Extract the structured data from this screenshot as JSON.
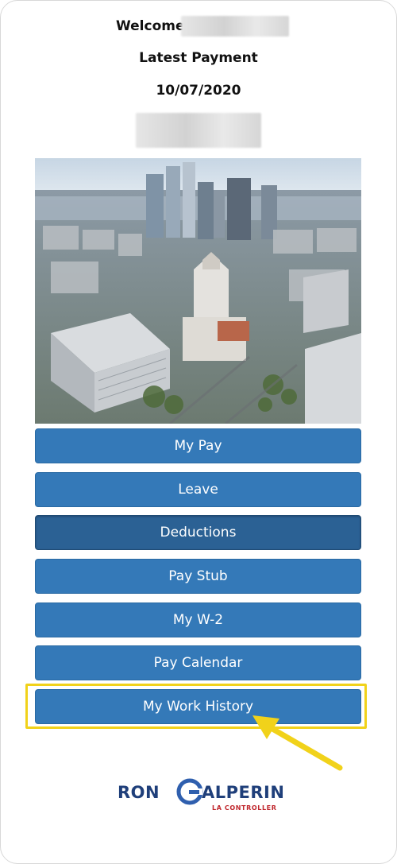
{
  "header": {
    "welcome_label": "Welcome",
    "latest_payment_label": "Latest Payment",
    "latest_payment_date": "10/07/2020"
  },
  "hero_image": {
    "description_icon": "city-skyline-image"
  },
  "menu": {
    "items": [
      {
        "label": "My Pay",
        "state": "default"
      },
      {
        "label": "Leave",
        "state": "default"
      },
      {
        "label": "Deductions",
        "state": "active"
      },
      {
        "label": "Pay Stub",
        "state": "default"
      },
      {
        "label": "My W-2",
        "state": "default"
      },
      {
        "label": "Pay Calendar",
        "state": "default"
      },
      {
        "label": "My Work History",
        "state": "highlighted"
      }
    ]
  },
  "annotation": {
    "highlight_color": "#f1d21a",
    "arrow_icon": "yellow-arrow-icon"
  },
  "footer_logo": {
    "part1": "RON",
    "g_letter": "G",
    "part2": "ALPERIN",
    "subtitle": "LA CONTROLLER",
    "primary_color": "#1f3f7a",
    "accent_color": "#c0272d"
  },
  "colors": {
    "button": "#3479b8",
    "button_active": "#2b6194"
  }
}
